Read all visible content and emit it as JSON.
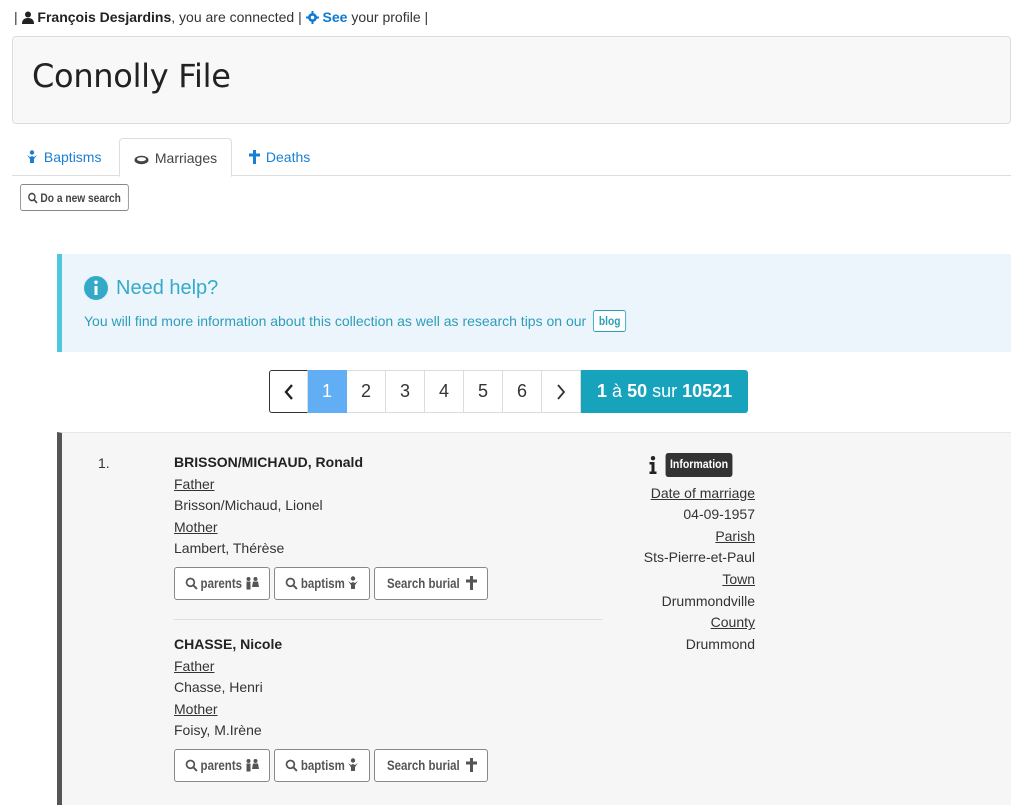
{
  "topbar": {
    "sep1": "|",
    "user": "François Desjardins",
    "connected": ", you are connected |",
    "see": "See",
    "profile": "your profile |"
  },
  "page_title": "Connolly File",
  "tabs": [
    {
      "label": "Baptisms",
      "icon": "baptism-icon",
      "active": false
    },
    {
      "label": "Marriages",
      "icon": "rings-icon",
      "active": true
    },
    {
      "label": "Deaths",
      "icon": "cross-icon",
      "active": false
    }
  ],
  "new_search_label": "Do a new search",
  "help": {
    "title": "Need help?",
    "text": "You will find more information about this collection as well as research tips on our",
    "blog_label": "blog"
  },
  "pagination": {
    "prev": "‹",
    "pages": [
      "1",
      "2",
      "3",
      "4",
      "5",
      "6"
    ],
    "current": "1",
    "next": "›",
    "range_from": "1",
    "range_word": "à",
    "range_to": "50",
    "total_word": "sur",
    "total": "10521"
  },
  "record": {
    "number": "1.",
    "persons": [
      {
        "name": "BRISSON/MICHAUD, Ronald",
        "father_label": "Father",
        "father": "Brisson/Michaud, Lionel",
        "mother_label": "Mother",
        "mother": "Lambert, Thérèse",
        "buttons": [
          "parents",
          "baptism",
          "Search burial"
        ]
      },
      {
        "name": "CHASSE, Nicole",
        "father_label": "Father",
        "father": "Chasse, Henri",
        "mother_label": "Mother",
        "mother": "Foisy, M.Irène",
        "buttons": [
          "parents",
          "baptism",
          "Search burial"
        ]
      }
    ],
    "info": {
      "tag": "Information",
      "date_label": "Date of marriage",
      "date": "04-09-1957",
      "parish_label": "Parish",
      "parish": "Sts-Pierre-et-Paul",
      "town_label": "Town",
      "town": "Drummondville",
      "county_label": "County",
      "county": "Drummond"
    }
  },
  "colors": {
    "link": "#0d7bd3",
    "accent_teal": "#18a3bd",
    "help_bg": "#edf5fc",
    "active_page": "#62aef4"
  }
}
